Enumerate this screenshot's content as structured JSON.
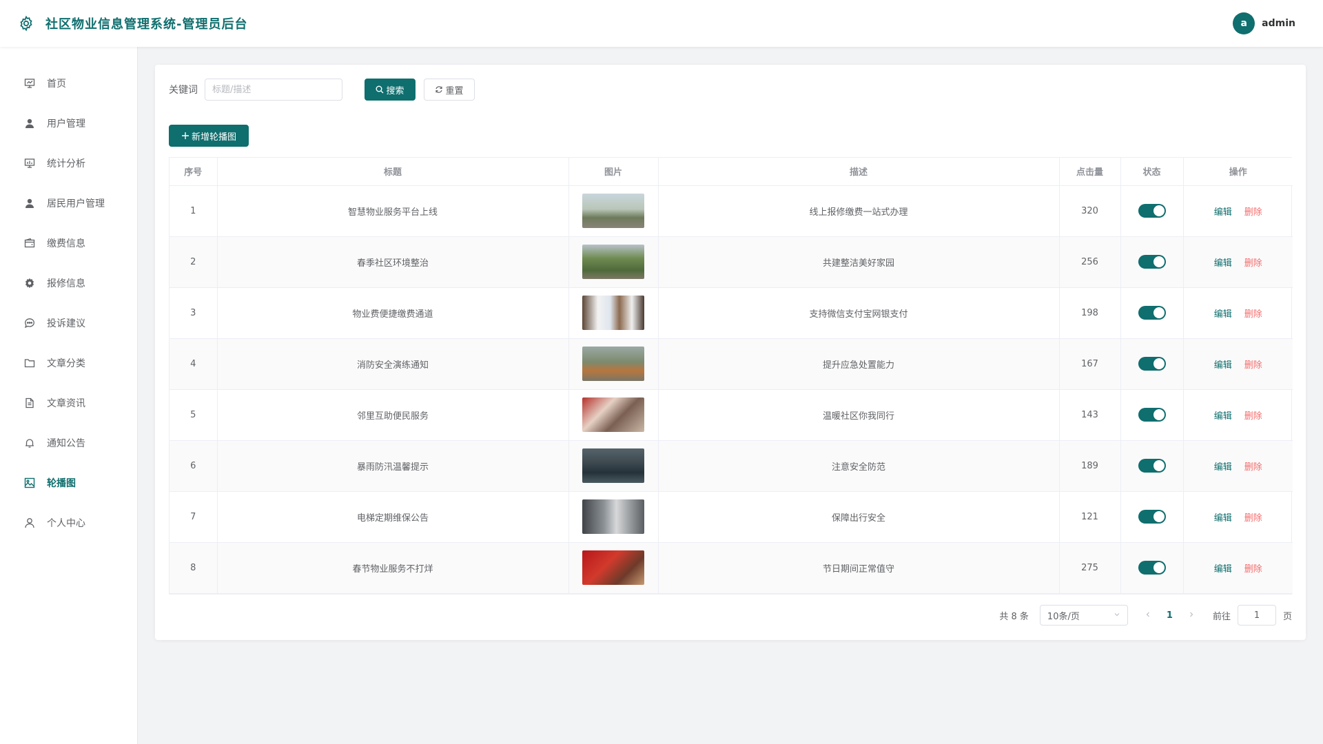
{
  "header": {
    "title": "社区物业信息管理系统-管理员后台",
    "avatar_letter": "a",
    "username": "admin",
    "accent": "#0f6e6e"
  },
  "sidebar": {
    "items": [
      {
        "label": "首页",
        "icon": "dashboard-icon"
      },
      {
        "label": "用户管理",
        "icon": "user-icon"
      },
      {
        "label": "统计分析",
        "icon": "chart-icon"
      },
      {
        "label": "居民用户管理",
        "icon": "user-icon"
      },
      {
        "label": "缴费信息",
        "icon": "wallet-icon"
      },
      {
        "label": "报修信息",
        "icon": "gear-icon"
      },
      {
        "label": "投诉建议",
        "icon": "chat-icon"
      },
      {
        "label": "文章分类",
        "icon": "folder-icon"
      },
      {
        "label": "文章资讯",
        "icon": "document-icon"
      },
      {
        "label": "通知公告",
        "icon": "bell-icon"
      },
      {
        "label": "轮播图",
        "icon": "picture-icon",
        "active": true
      },
      {
        "label": "个人中心",
        "icon": "person-icon"
      }
    ]
  },
  "search": {
    "label": "关键词",
    "placeholder": "标题/描述",
    "value": "",
    "search_label": "搜索",
    "reset_label": "重置",
    "add_label": "新增轮播图"
  },
  "table": {
    "columns": [
      "序号",
      "标题",
      "图片",
      "描述",
      "点击量",
      "状态",
      "操作"
    ],
    "edit_label": "编辑",
    "delete_label": "删除",
    "rows": [
      {
        "index": "1",
        "title": "智慧物业服务平台上线",
        "description": "线上报修缴费一站式办理",
        "clicks": "320",
        "enabled": true
      },
      {
        "index": "2",
        "title": "春季社区环境整治",
        "description": "共建整洁美好家园",
        "clicks": "256",
        "enabled": true
      },
      {
        "index": "3",
        "title": "物业费便捷缴费通道",
        "description": "支持微信支付宝网银支付",
        "clicks": "198",
        "enabled": true
      },
      {
        "index": "4",
        "title": "消防安全演练通知",
        "description": "提升应急处置能力",
        "clicks": "167",
        "enabled": true
      },
      {
        "index": "5",
        "title": "邻里互助便民服务",
        "description": "温暖社区你我同行",
        "clicks": "143",
        "enabled": true
      },
      {
        "index": "6",
        "title": "暴雨防汛温馨提示",
        "description": "注意安全防范",
        "clicks": "189",
        "enabled": true
      },
      {
        "index": "7",
        "title": "电梯定期维保公告",
        "description": "保障出行安全",
        "clicks": "121",
        "enabled": true
      },
      {
        "index": "8",
        "title": "春节物业服务不打烊",
        "description": "节日期间正常值守",
        "clicks": "275",
        "enabled": true
      }
    ]
  },
  "pagination": {
    "total_text": "共 8 条",
    "page_size": "10条/页",
    "current_page": "1",
    "goto_label": "前往",
    "goto_value": "1",
    "page_suffix": "页"
  }
}
